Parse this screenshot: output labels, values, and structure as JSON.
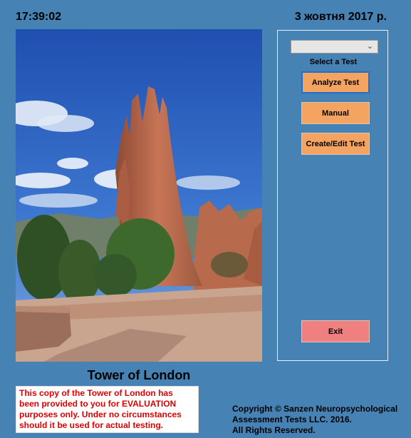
{
  "header": {
    "time": "17:39:02",
    "date": "3 жовтня 2017 р."
  },
  "panel": {
    "select_value": "",
    "select_label": "Select a Test",
    "buttons": {
      "analyze": "Analyze Test",
      "manual": "Manual",
      "create_edit": "Create/Edit Test",
      "exit": "Exit"
    }
  },
  "main": {
    "title": "Tower of London",
    "evaluation_notice": "This copy of the Tower of London has been provided to you for EVALUATION purposes only. Under no circumstances should it be used for actual testing.",
    "copyright_lines": [
      "Copyright © Sanzen Neuropsychological",
      "Assessment Tests LLC. 2016.",
      "All Rights Reserved."
    ]
  },
  "colors": {
    "background": "#4682b4",
    "button": "#f4a460",
    "exit_button": "#f08080",
    "notice_text": "#e00000"
  }
}
